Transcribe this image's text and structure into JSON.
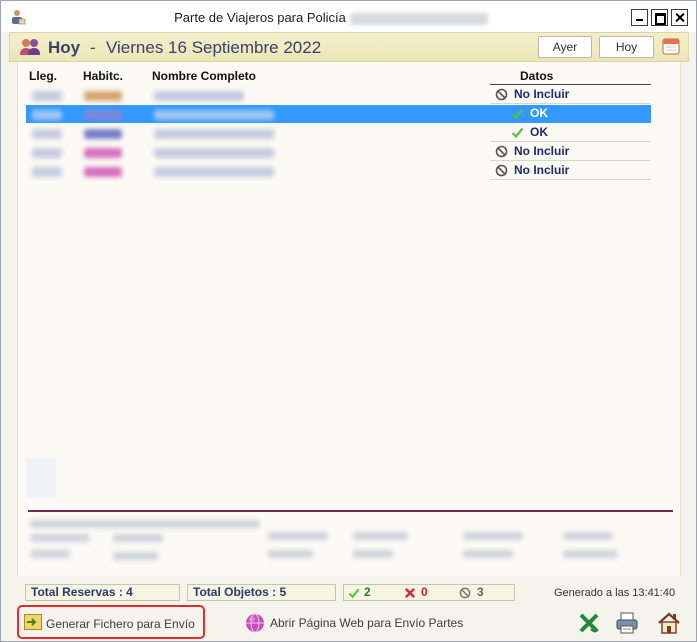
{
  "window": {
    "title": "Parte de Viajeros para Policía",
    "icon": "user-icon"
  },
  "header": {
    "title": "Hoy",
    "separator": "-",
    "date": "Viernes 16 Septiembre 2022",
    "yesterday_button": "Ayer",
    "today_button": "Hoy",
    "calendar_icon": "calendar-icon"
  },
  "table": {
    "columns": {
      "lleg": "Lleg.",
      "habitc": "Habitc.",
      "nombre": "Nombre Completo",
      "datos": "Datos"
    },
    "rows": [
      {
        "datos": "No Incluir",
        "status": "no-incluir"
      },
      {
        "datos": "OK",
        "status": "ok",
        "selected": true
      },
      {
        "datos": "OK",
        "status": "ok"
      },
      {
        "datos": "No Incluir",
        "status": "no-incluir"
      },
      {
        "datos": "No Incluir",
        "status": "no-incluir"
      }
    ]
  },
  "stats": {
    "total_reservas": "Total Reservas : 4",
    "total_objetos": "Total Objetos : 5",
    "ok_count": "2",
    "error_count": "0",
    "excluded_count": "3",
    "generated": "Generado a las 13:41:40"
  },
  "actions": {
    "generate_file": "Generar Fichero para Envío",
    "open_web": "Abrir Página Web para Envío Partes",
    "excel_icon": "excel-icon",
    "print_icon": "printer-icon",
    "home_icon": "home-icon"
  },
  "colors": {
    "selection": "#3399ff",
    "header_bg": "#f3efcb",
    "title_text": "#39406a",
    "highlight_border": "#e32b2b",
    "divider": "#6e2a52"
  }
}
